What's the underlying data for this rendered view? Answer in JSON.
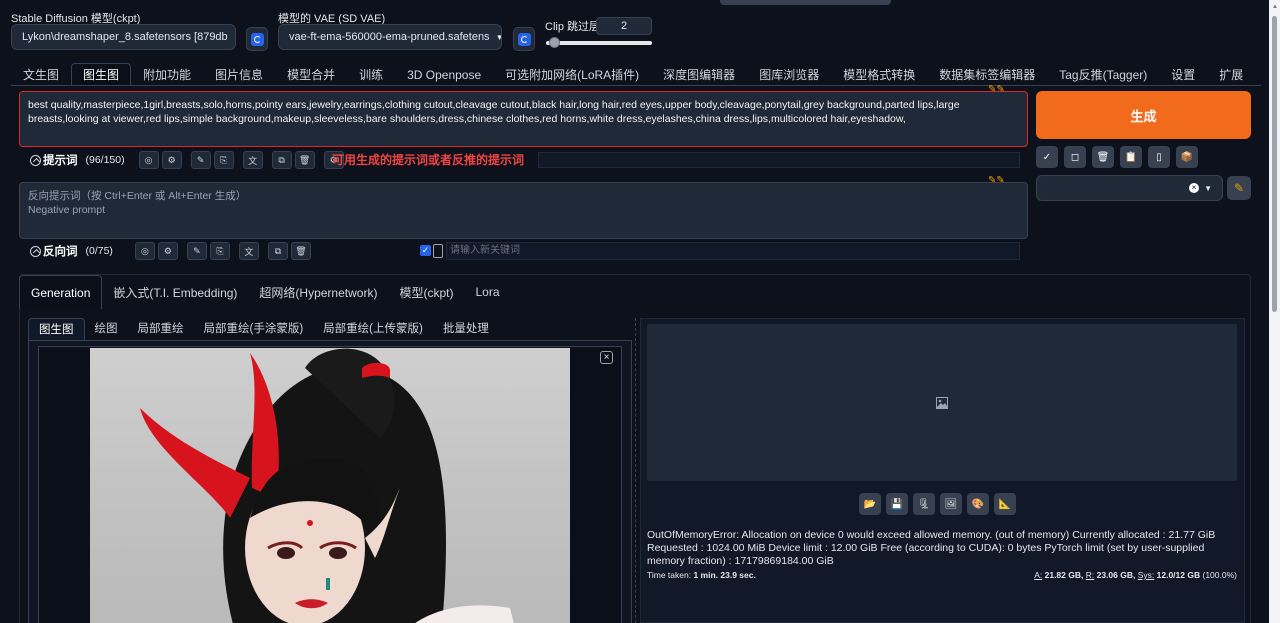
{
  "checkpoint": {
    "label": "Stable Diffusion 模型(ckpt)",
    "value": "Lykon\\dreamshaper_8.safetensors [879db"
  },
  "vae": {
    "label": "模型的 VAE (SD VAE)",
    "value": "vae-ft-ema-560000-ema-pruned.safetens"
  },
  "clip": {
    "label": "Clip 跳过层",
    "value": "2",
    "slider_fraction": 0.08
  },
  "main_tabs": [
    "文生图",
    "图生图",
    "附加功能",
    "图片信息",
    "模型合并",
    "训练",
    "3D Openpose",
    "可选附加网络(LoRA插件)",
    "深度图编辑器",
    "图库浏览器",
    "模型格式转换",
    "数据集标签编辑器",
    "Tag反推(Tagger)",
    "设置",
    "扩展"
  ],
  "active_main_tab": "图生图",
  "prompt": {
    "text": "best quality,masterpiece,1girl,breasts,solo,horns,pointy ears,jewelry,earrings,clothing cutout,cleavage cutout,black hair,long hair,red eyes,upper body,cleavage,ponytail,grey background,parted lips,large breasts,looking at viewer,red lips,simple background,makeup,sleeveless,bare shoulders,dress,chinese clothes,red horns,white dress,eyelashes,china dress,lips,multicolored hair,eyeshadow,",
    "title": "提示词",
    "count": "(96/150)",
    "annotation": "可用生成的提示词或者反推的提示词"
  },
  "negative": {
    "placeholder_line1": "反向提示词（按 Ctrl+Enter 或 Alt+Enter 生成）",
    "placeholder_line2": "Negative prompt",
    "title": "反向词",
    "count": "(0/75)",
    "keyword_placeholder": "请输入新关键词",
    "keyword_checked": true
  },
  "generate_label": "生成",
  "style_buttons": [
    "✓",
    "◻",
    "🗑",
    "📋",
    "▯",
    "📦"
  ],
  "network_tabs": [
    "Generation",
    "嵌入式(T.I. Embedding)",
    "超网络(Hypernetwork)",
    "模型(ckpt)",
    "Lora"
  ],
  "active_network_tab": "Generation",
  "img2img_tabs": [
    "图生图",
    "绘图",
    "局部重绘",
    "局部重绘(手涂蒙版)",
    "局部重绘(上传蒙版)",
    "批量处理"
  ],
  "active_img2img_tab": "图生图",
  "output": {
    "error": "OutOfMemoryError: Allocation on device 0 would exceed allowed memory. (out of memory) Currently allocated : 21.77 GiB Requested : 1024.00 MiB Device limit : 12.00 GiB Free (according to CUDA): 0 bytes PyTorch limit (set by user-supplied memory fraction) : 17179869184.00 GiB",
    "time_label": "Time taken:",
    "time_value": "1 min. 23.9 sec.",
    "mem_a_label": "A:",
    "mem_a": "21.82 GB,",
    "mem_r_label": "R:",
    "mem_r": "23.06 GB,",
    "mem_sys_label": "Sys:",
    "mem_sys": "12.0/12 GB",
    "mem_pct": "(100.0%)"
  },
  "colors": {
    "accent": "#f26a1b",
    "annotation": "#ef4444",
    "bg": "#0c111c"
  }
}
